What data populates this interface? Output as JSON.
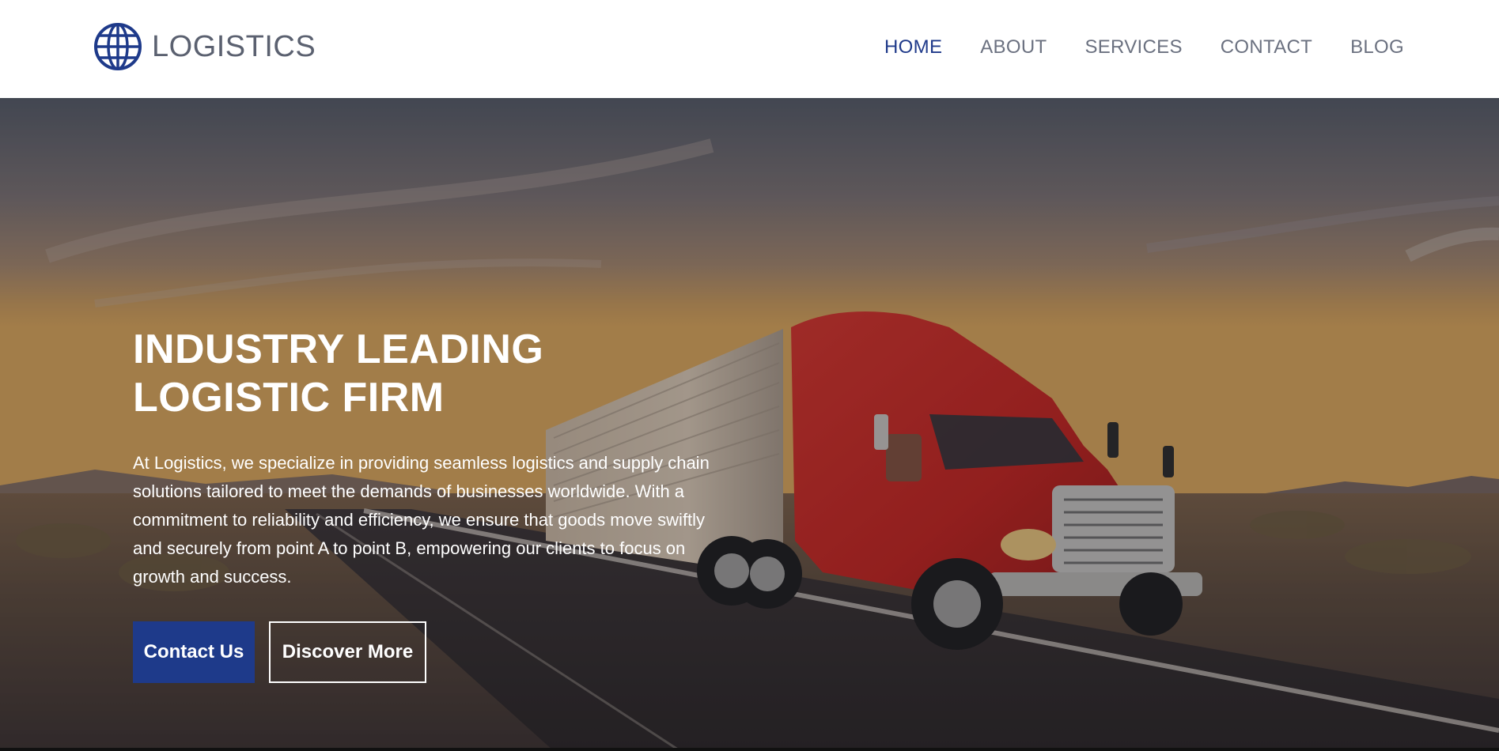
{
  "brand": {
    "name": "LOGISTICS",
    "icon": "globe-icon",
    "accent_color": "#1e3a8a"
  },
  "nav": {
    "items": [
      {
        "label": "HOME",
        "active": true
      },
      {
        "label": "ABOUT",
        "active": false
      },
      {
        "label": "SERVICES",
        "active": false
      },
      {
        "label": "CONTACT",
        "active": false
      },
      {
        "label": "BLOG",
        "active": false
      }
    ]
  },
  "hero": {
    "title_line1": "INDUSTRY LEADING",
    "title_line2": "LOGISTIC FIRM",
    "description": "At Logistics, we specialize in providing seamless logistics and supply chain solutions tailored to meet the demands of businesses worldwide. With a commitment to reliability and efficiency, we ensure that goods move swiftly and securely from point A to point B, empowering our clients to focus on growth and success.",
    "primary_button": "Contact Us",
    "secondary_button": "Discover More",
    "background_image": "red-semi-truck-on-highway-at-sunset"
  }
}
